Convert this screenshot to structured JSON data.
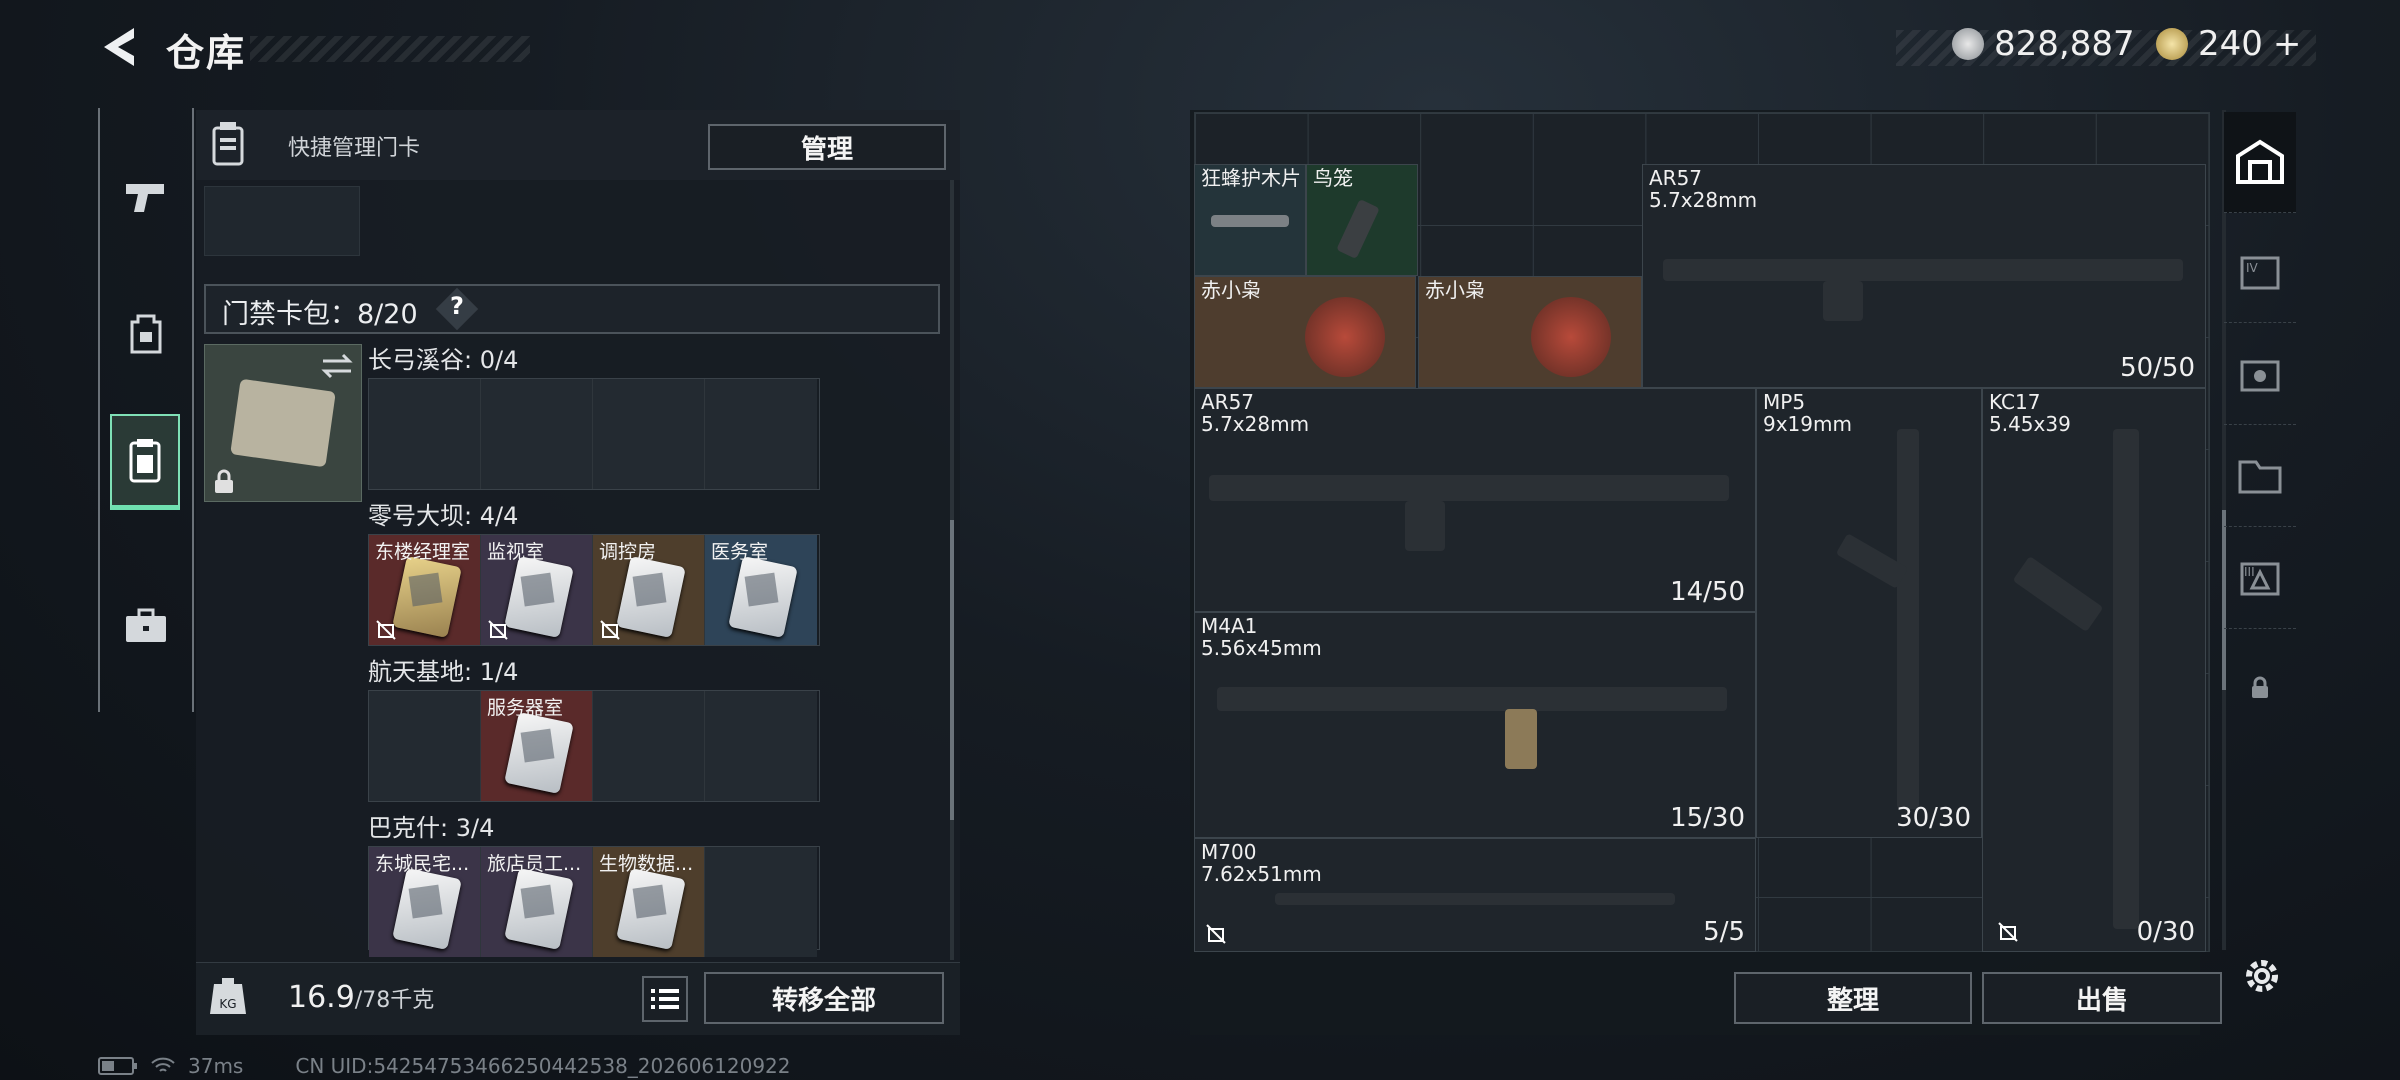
{
  "header": {
    "title": "仓库",
    "currency1": "828,887",
    "currency2": "240",
    "plus": "+"
  },
  "tabs": [
    "weapon-tab",
    "backpack-tab",
    "keycard-tab",
    "briefcase-tab"
  ],
  "left": {
    "quick_manage_label": "快捷管理门卡",
    "manage_button": "管理",
    "card_pack": "门禁卡包：8/20",
    "help": "?",
    "regions": [
      {
        "title": "长弓溪谷: 0/4",
        "slots": [
          "",
          "",
          "",
          ""
        ]
      },
      {
        "title": "零号大坝: 4/4",
        "slots": [
          "东楼经理室",
          "监视室",
          "调控房",
          "医务室"
        ]
      },
      {
        "title": "航天基地: 1/4",
        "slots": [
          "",
          "服务器室",
          "",
          ""
        ]
      },
      {
        "title": "巴克什: 3/4",
        "slots": [
          "东城民宅...",
          "旅店员工...",
          "生物数据...",
          ""
        ]
      }
    ],
    "weight": "16.9",
    "weight_max": "/78千克",
    "transfer_all": "转移全部"
  },
  "right": {
    "items": [
      {
        "name": "狂蜂护木片"
      },
      {
        "name": "鸟笼"
      },
      {
        "name": "赤小枭"
      },
      {
        "name": "赤小枭"
      },
      {
        "name": "AR57\n5.7x28mm",
        "count": "50/50"
      },
      {
        "name": "AR57\n5.7x28mm",
        "count": "14/50"
      },
      {
        "name": "MP5\n9x19mm",
        "count": "30/30"
      },
      {
        "name": "KC17\n5.45x39",
        "count": "0/30"
      },
      {
        "name": "M4A1\n5.56x45mm",
        "count": "15/30"
      },
      {
        "name": "M700\n7.62x51mm",
        "count": "5/5"
      }
    ],
    "sort_button": "整理",
    "sell_button": "出售"
  },
  "status": {
    "ping": "37ms",
    "uid": "CN UID:54254753466250442538_202606120922"
  },
  "colors": {
    "accent": "#6fe0b0",
    "slot_red": "#5a2a2a",
    "slot_purple": "#3b3448",
    "slot_gold": "#4e3e2c",
    "slot_blue": "#2e4458"
  }
}
